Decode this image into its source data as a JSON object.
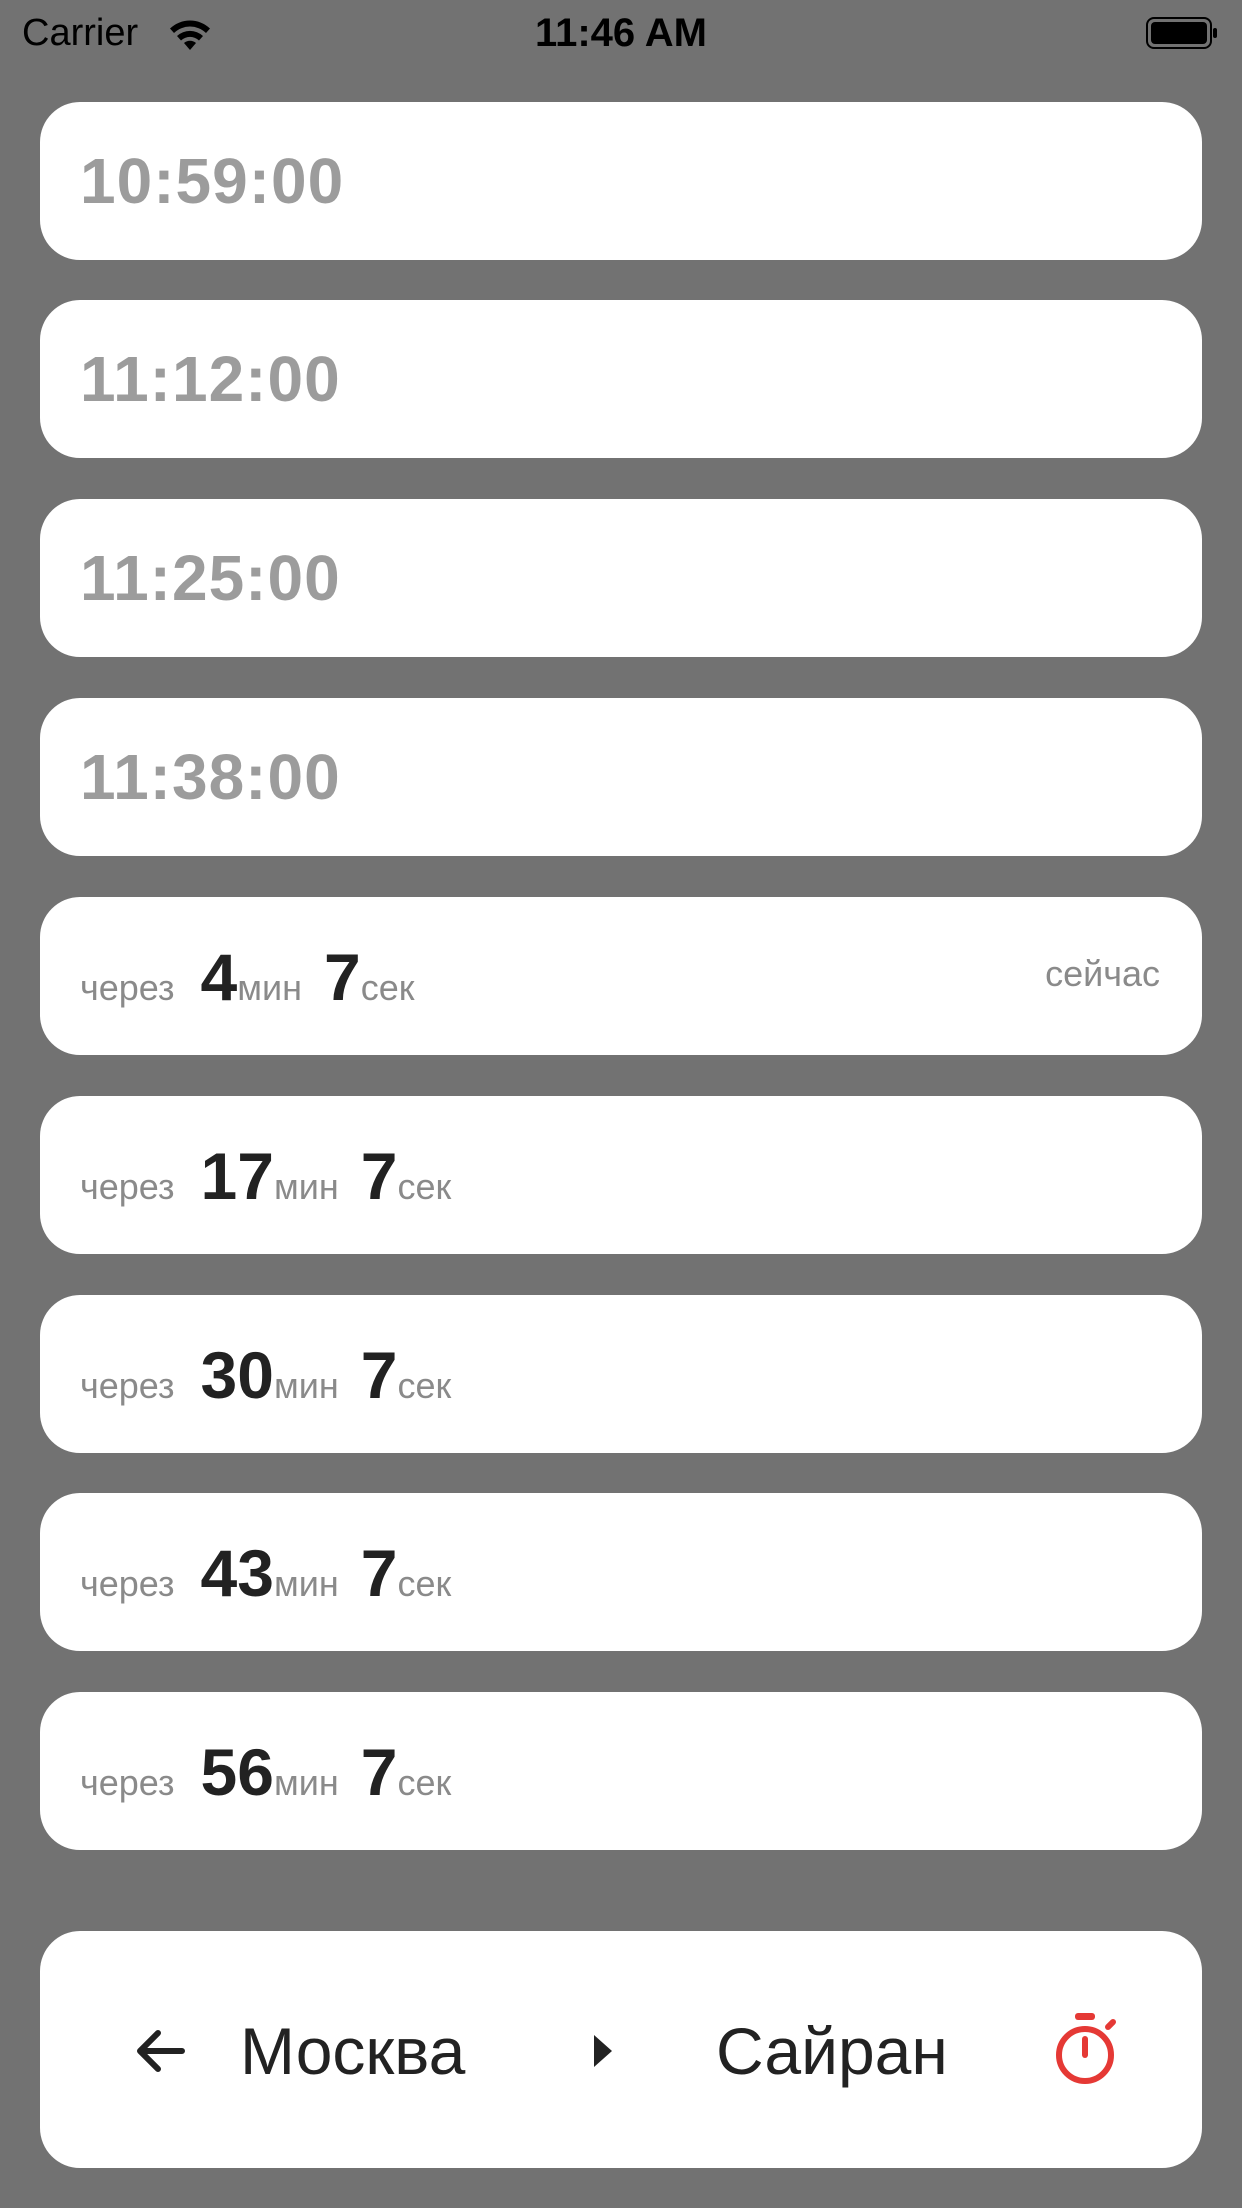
{
  "status_bar": {
    "carrier": "Carrier",
    "time": "11:46 AM",
    "icons": [
      "wifi-icon",
      "battery-icon"
    ]
  },
  "past_departures": [
    {
      "time": "10:59:00"
    },
    {
      "time": "11:12:00"
    },
    {
      "time": "11:25:00"
    },
    {
      "time": "11:38:00"
    }
  ],
  "upcoming_departures": [
    {
      "prefix": "через",
      "minutes": "4",
      "min_unit": "мин",
      "seconds": "7",
      "sec_unit": "сек",
      "badge": "сейчас"
    },
    {
      "prefix": "через",
      "minutes": "17",
      "min_unit": "мин",
      "seconds": "7",
      "sec_unit": "сек"
    },
    {
      "prefix": "через",
      "minutes": "30",
      "min_unit": "мин",
      "seconds": "7",
      "sec_unit": "сек"
    },
    {
      "prefix": "через",
      "minutes": "43",
      "min_unit": "мин",
      "seconds": "7",
      "sec_unit": "сек"
    },
    {
      "prefix": "через",
      "minutes": "56",
      "min_unit": "мин",
      "seconds": "7",
      "sec_unit": "сек"
    }
  ],
  "route": {
    "from": "Москва",
    "to": "Сайран",
    "icons": [
      "back-arrow-icon",
      "play-triangle-icon",
      "stopwatch-icon"
    ],
    "accent_color": "#e53935"
  }
}
